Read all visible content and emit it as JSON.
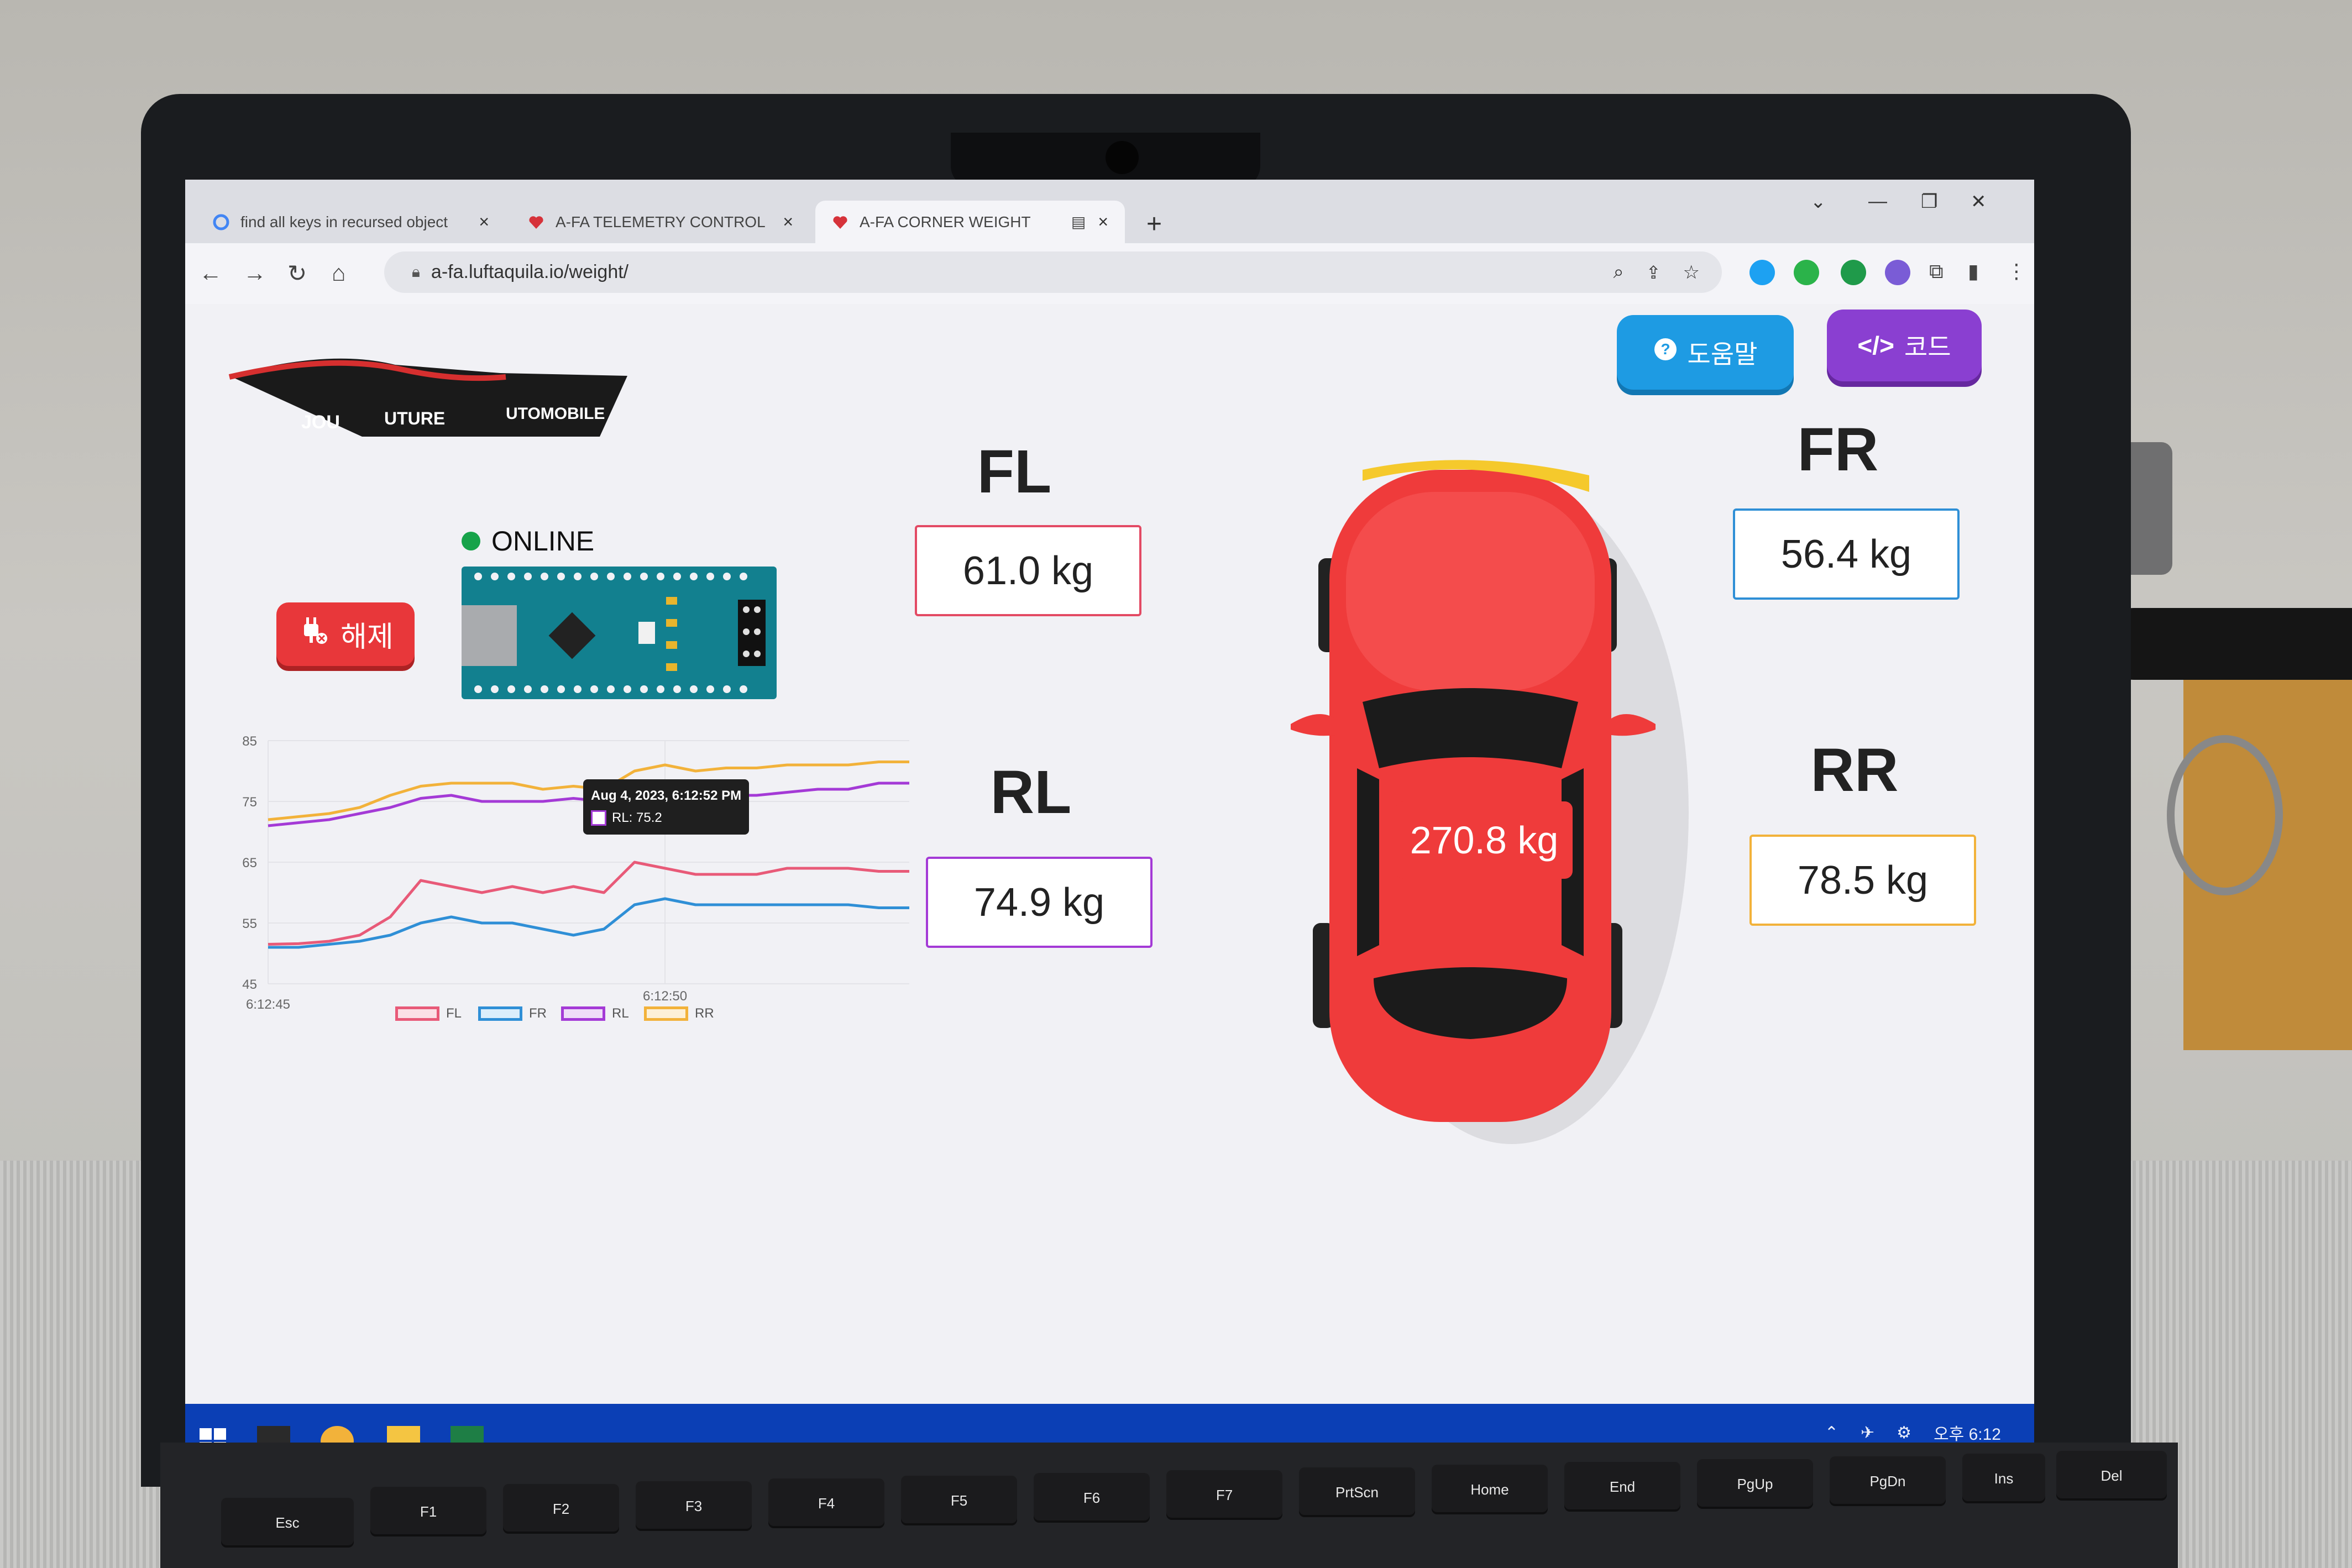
{
  "browser": {
    "tabs": [
      {
        "title": "find all keys in recursed object",
        "active": false
      },
      {
        "title": "A-FA TELEMETRY CONTROL",
        "active": false
      },
      {
        "title": "A-FA CORNER WEIGHT",
        "active": true
      }
    ],
    "url": "a-fa.luftaquila.io/weight/",
    "new_tab": "+"
  },
  "page": {
    "logo_text": {
      "a": "JOU",
      "f": "UTURE",
      "af": "UTOMOBILE"
    },
    "help_button": "도움말",
    "code_button": "코드",
    "disconnect_button": "해제",
    "status": "ONLINE",
    "wheels": {
      "FL": {
        "label": "FL",
        "value": "61.0 kg",
        "color": "#e34a64"
      },
      "FR": {
        "label": "FR",
        "value": "56.4 kg",
        "color": "#2f8fd6"
      },
      "RL": {
        "label": "RL",
        "value": "74.9 kg",
        "color": "#a43ad6"
      },
      "RR": {
        "label": "RR",
        "value": "78.5 kg",
        "color": "#f2b23a"
      }
    },
    "total": "270.8 kg",
    "tooltip": {
      "title": "Aug 4, 2023, 6:12:52 PM",
      "line": "RL: 75.2"
    }
  },
  "chart_data": {
    "type": "line",
    "title": "",
    "xlabel": "",
    "ylabel": "",
    "ylim": [
      45,
      85
    ],
    "yticks": [
      "85",
      "75",
      "65",
      "55",
      "45"
    ],
    "xticks": [
      "6:12:45",
      "6:12:50"
    ],
    "x": [
      0,
      1,
      2,
      3,
      4,
      5,
      6,
      7,
      8,
      9,
      10,
      11,
      12,
      13,
      14,
      15,
      16,
      17,
      18,
      19,
      20,
      21
    ],
    "series": [
      {
        "name": "FL",
        "color": "#e85a78",
        "values": [
          51.5,
          51.6,
          52,
          53,
          56,
          62,
          61,
          60,
          61,
          60,
          61,
          60,
          65,
          64,
          63,
          63,
          63,
          64,
          64,
          64,
          63.5,
          63.5
        ]
      },
      {
        "name": "FR",
        "color": "#2f8fd6",
        "values": [
          51,
          51,
          51.5,
          52,
          53,
          55,
          56,
          55,
          55,
          54,
          53,
          54,
          58,
          59,
          58,
          58,
          58,
          58,
          58,
          58,
          57.5,
          57.5
        ]
      },
      {
        "name": "RL",
        "color": "#a43ad6",
        "values": [
          71,
          71.5,
          72,
          73,
          74,
          75.5,
          76,
          75,
          75,
          75,
          75.5,
          75,
          77,
          77,
          76,
          76,
          76,
          76.5,
          77,
          77,
          78,
          78
        ]
      },
      {
        "name": "RR",
        "color": "#f2b23a",
        "values": [
          72,
          72.5,
          73,
          74,
          76,
          77.5,
          78,
          78,
          78,
          77,
          77.5,
          77,
          80,
          81,
          80,
          80.5,
          80.5,
          81,
          81,
          81,
          81.5,
          81.5
        ]
      }
    ]
  },
  "taskbar": {
    "time": "오후 6:12"
  },
  "keyboard": {
    "keys": [
      "Esc",
      "F1",
      "F2",
      "F3",
      "F4",
      "F5",
      "F6",
      "F7",
      "PrtScn",
      "Home",
      "End",
      "PgUp",
      "PgDn",
      "Ins",
      "Del"
    ]
  }
}
